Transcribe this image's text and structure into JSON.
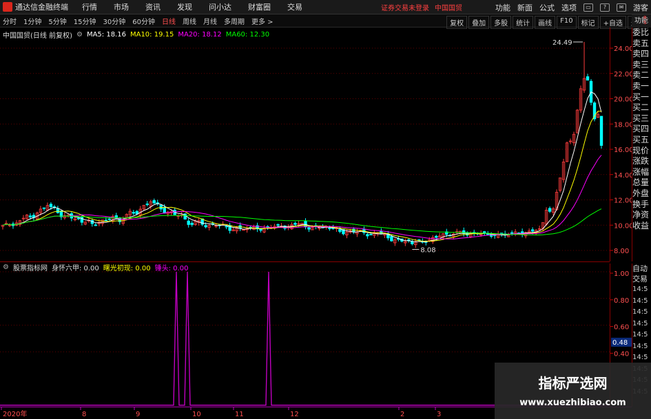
{
  "menubar": {
    "title": "通达信金融终端",
    "items": [
      "行情",
      "市场",
      "资讯",
      "发现",
      "问小达",
      "财富圈",
      "交易"
    ],
    "notice": "证券交易未登录",
    "notice_stock": "中国国贸",
    "right_items": [
      "功能",
      "新面",
      "公式",
      "选项"
    ],
    "user": "游客"
  },
  "periodbar": {
    "periods": [
      "分时",
      "1分钟",
      "5分钟",
      "15分钟",
      "30分钟",
      "60分钟",
      "日线",
      "周线",
      "月线",
      "多周期",
      "更多 >"
    ],
    "active": "日线",
    "tools": [
      "复权",
      "叠加",
      "多股",
      "统计",
      "画线",
      "F10",
      "标记",
      "+自选",
      "返回"
    ]
  },
  "legend": {
    "stock": "中国国贸(日线 前复权)",
    "ma5": "MA5: 18.16",
    "ma10": "MA10: 19.15",
    "ma20": "MA20: 18.12",
    "ma60": "MA60: 12.30"
  },
  "sublegend": {
    "site": "股票指标网",
    "name1": "身怀六甲: 0.00",
    "name2": "曙光初现: 0.00",
    "name3": "锤头: 0.00"
  },
  "main_chart": {
    "y_ticks": [
      "24.00",
      "22.00",
      "20.00",
      "18.00",
      "16.00",
      "14.00",
      "12.00",
      "10.00",
      "8.00"
    ],
    "high_label": "24.49",
    "low_label": "8.08",
    "colors": {
      "up": "#ff3c3c",
      "down": "#00ffff",
      "ma5": "#ffffff",
      "ma10": "#ffff00",
      "ma20": "#ff00ff",
      "ma60": "#00ff00",
      "grid": "#600000"
    }
  },
  "sub_chart": {
    "y_ticks": [
      "1.00",
      "0.80",
      "0.60",
      "0.40"
    ],
    "current": "0.48",
    "spike_color": "#c000c0"
  },
  "date_axis": {
    "labels": [
      "2020年",
      "8",
      "9",
      "10",
      "11",
      "12",
      "2",
      "3"
    ]
  },
  "side_panel": {
    "items": [
      "委比",
      "卖五",
      "卖四",
      "卖三",
      "卖二",
      "卖一",
      "买一",
      "买二",
      "买三",
      "买四",
      "买五",
      "现价",
      "涨跌",
      "涨幅",
      "总量",
      "外盘",
      "换手",
      "净资",
      "收益"
    ]
  },
  "side_panel2": {
    "label1": "自动",
    "label2": "交易",
    "times": [
      "14:5",
      "14:5",
      "14:5",
      "14:5",
      "14:5",
      "14:5",
      "14:5",
      "14:5",
      "14:5",
      "14:5"
    ]
  },
  "side_top": "功能",
  "watermark": {
    "title": "指标严选网",
    "url": "www.xuezhibiao.com"
  }
}
